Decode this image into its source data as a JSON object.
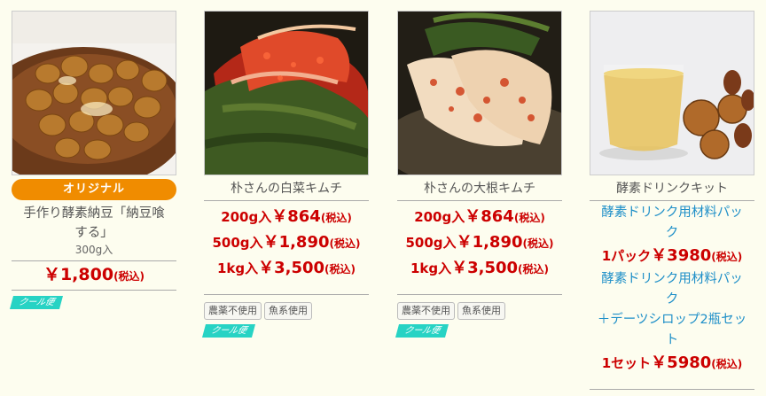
{
  "products": [
    {
      "image": "natto-bowl-photo",
      "badge": "オリジナル",
      "name": "手作り酵素納豆「納豆喰する」",
      "name_line1": "手作り酵素納豆「納豆喰",
      "name_line2": "する」",
      "size": "300g入",
      "price_prefix": "￥",
      "price_amount": "1,800",
      "price_tax": "(税込)",
      "shipping": "クール便"
    },
    {
      "image": "napa-kimchi-photo",
      "name": "朴さんの白菜キムチ",
      "prices": [
        {
          "qty": "200g入",
          "yen": "￥",
          "amount": "864",
          "tax": "(税込)"
        },
        {
          "qty": "500g入",
          "yen": "￥",
          "amount": "1,890",
          "tax": "(税込)"
        },
        {
          "qty": "1kg入",
          "yen": "￥",
          "amount": "3,500",
          "tax": "(税込)"
        }
      ],
      "tags": [
        "農薬不使用",
        "魚系使用"
      ],
      "shipping": "クール便"
    },
    {
      "image": "radish-kimchi-photo",
      "name": "朴さんの大根キムチ",
      "prices": [
        {
          "qty": "200g入",
          "yen": "￥",
          "amount": "864",
          "tax": "(税込)"
        },
        {
          "qty": "500g入",
          "yen": "￥",
          "amount": "1,890",
          "tax": "(税込)"
        },
        {
          "qty": "1kg入",
          "yen": "￥",
          "amount": "3,500",
          "tax": "(税込)"
        }
      ],
      "tags": [
        "農薬不使用",
        "魚系使用"
      ],
      "shipping": "クール便"
    },
    {
      "image": "enzyme-drink-photo",
      "name": "酵素ドリンクキット",
      "option1_line1": "酵素ドリンク用材料パッ",
      "option1_line2": "ク",
      "option1_price": {
        "qty": "1パック",
        "yen": "￥",
        "amount": "3980",
        "tax": "(税込)"
      },
      "option2_line1": "酵素ドリンク用材料パッ",
      "option2_line2": "ク",
      "option2_line3": "＋デーツシロップ2瓶セッ",
      "option2_line4": "ト",
      "option2_price": {
        "qty": "1セット",
        "yen": "￥",
        "amount": "5980",
        "tax": "(税込)"
      }
    }
  ],
  "colors": {
    "background": "#fdfdef",
    "badge": "#f08c00",
    "price": "#cc0000",
    "link": "#1e8fc8",
    "cool": "#27d3c4"
  }
}
